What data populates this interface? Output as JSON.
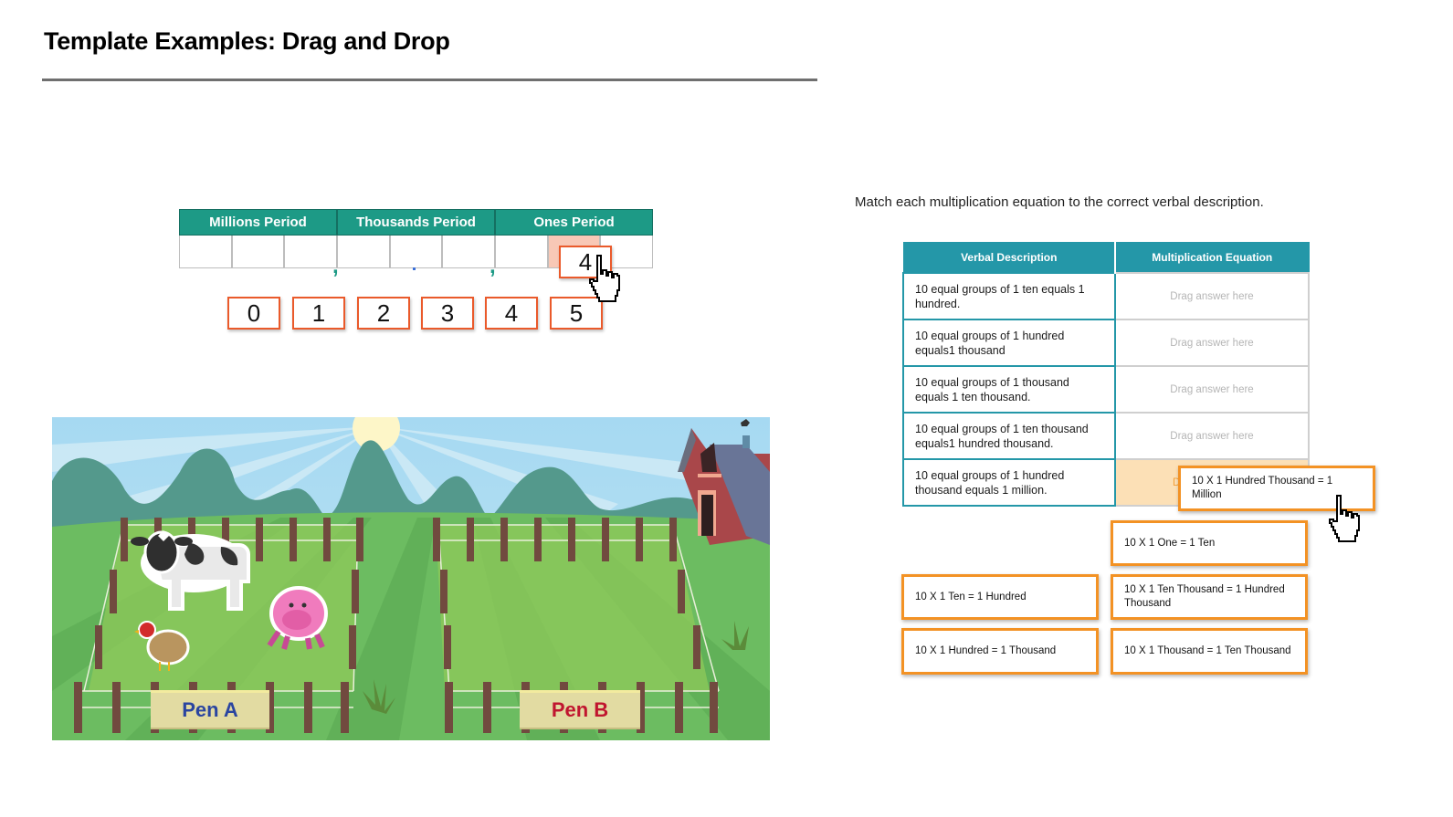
{
  "header": {
    "title": "Template Examples: Drag and Drop"
  },
  "place_value": {
    "periods": [
      "Millions Period",
      "Thousands Period",
      "Ones Period"
    ],
    "placed_digit": "4",
    "digit_tiles": [
      "0",
      "1",
      "2",
      "3",
      "4",
      "5"
    ],
    "comma": ","
  },
  "farm": {
    "pens": [
      {
        "label": "Pen A",
        "color": "#2a45a0"
      },
      {
        "label": "Pen B",
        "color": "#c0162f"
      }
    ],
    "animals": [
      "cow",
      "pig",
      "chicken"
    ]
  },
  "matching": {
    "instruction": "Match each multiplication equation to the correct verbal description.",
    "columns": [
      "Verbal Description",
      "Multiplication Equation"
    ],
    "rows": [
      {
        "description": "10 equal groups of 1 ten equals 1 hundred.",
        "placeholder": "Drag answer here"
      },
      {
        "description": "10 equal groups of 1 hundred equals1 thousand",
        "placeholder": "Drag answer here"
      },
      {
        "description": "10 equal groups of 1 thousand equals 1 ten thousand.",
        "placeholder": "Drag answer here"
      },
      {
        "description": "10 equal groups of 1 ten thousand equals1 hundred thousand.",
        "placeholder": "Drag answer here"
      },
      {
        "description": "10 equal groups of 1 hundred thousand equals 1 million.",
        "placeholder": "Drag answer here"
      }
    ],
    "dragging_card": "10 X 1 Hundred Thousand = 1 Million",
    "answer_cards": [
      "10 X 1 One = 1 Ten",
      "10 X 1 Ten = 1 Hundred",
      "10 X 1 Ten Thousand = 1 Hundred Thousand",
      "10 X 1 Hundred = 1 Thousand",
      "10 X 1 Thousand = 1 Ten Thousand"
    ],
    "colors": {
      "header": "#2497a8",
      "card_border": "#f39224",
      "active_drop": "#fce0b6"
    }
  }
}
